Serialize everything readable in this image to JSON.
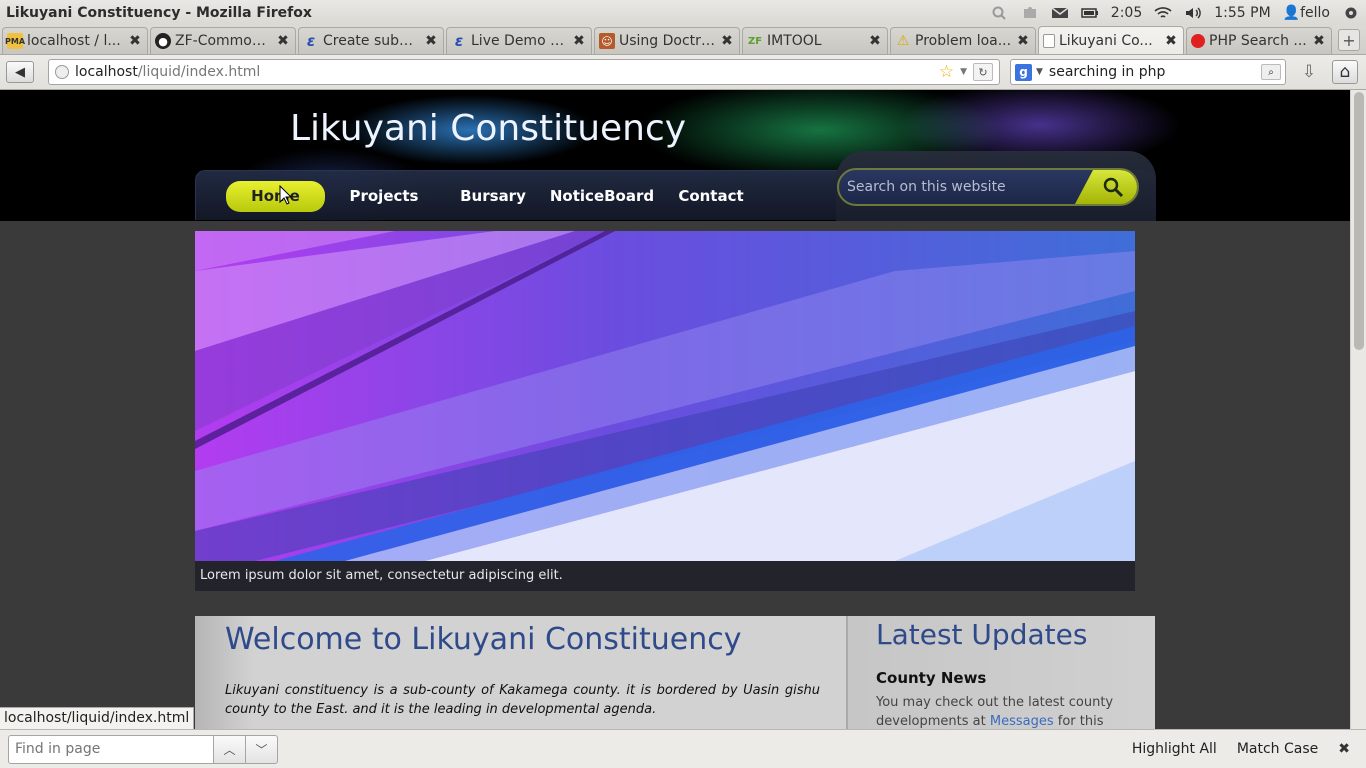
{
  "os": {
    "window_title": "Likuyani Constituency - Mozilla Firefox",
    "battery": "2:05",
    "clock": "1:55 PM",
    "user": "fello"
  },
  "tabs": [
    {
      "label": "localhost / l...",
      "icon": "phpmyadmin-icon"
    },
    {
      "label": "ZF-Common...",
      "icon": "github-icon"
    },
    {
      "label": "Create subg...",
      "icon": "e-icon"
    },
    {
      "label": "Live Demo - ...",
      "icon": "e-icon"
    },
    {
      "label": "Using Doctri...",
      "icon": "avatar-icon"
    },
    {
      "label": "IMTOOL",
      "icon": "zf-icon"
    },
    {
      "label": "Problem loa...",
      "icon": "warning-icon"
    },
    {
      "label": "Likuyani Co...",
      "icon": "blank-page-icon"
    },
    {
      "label": "PHP Search ...",
      "icon": "red-dot-icon"
    }
  ],
  "nav": {
    "url_host": "localhost",
    "url_path": "/liquid/index.html",
    "search_value": "searching in php"
  },
  "site": {
    "title": "Likuyani Constituency",
    "menu": [
      "Home",
      "Projects",
      "Bursary",
      "NoticeBoard",
      "Contact"
    ],
    "search_placeholder": "Search on this website",
    "hero_caption": "Lorem ipsum dolor sit amet, consectetur adipiscing elit.",
    "welcome_title": "Welcome to Likuyani Constituency",
    "welcome_text": "Likuyani constituency is a sub-county of Kakamega county. it is bordered by Uasin gishu county to the East. and it is the leading in developmental agenda.",
    "updates_title": "Latest Updates",
    "news_title": "County News",
    "news_text_before": "You may check out the latest county developments at ",
    "news_link": "Messages",
    "news_text_after": " for this"
  },
  "status": {
    "link_url": "localhost/liquid/index.html"
  },
  "findbar": {
    "placeholder": "Find in page",
    "highlight_all": "Highlight All",
    "match_case": "Match Case"
  },
  "colors": {
    "menu_active": "#d7e63a",
    "heading_blue": "#2f4a8a",
    "link_blue": "#3b6bc0"
  }
}
